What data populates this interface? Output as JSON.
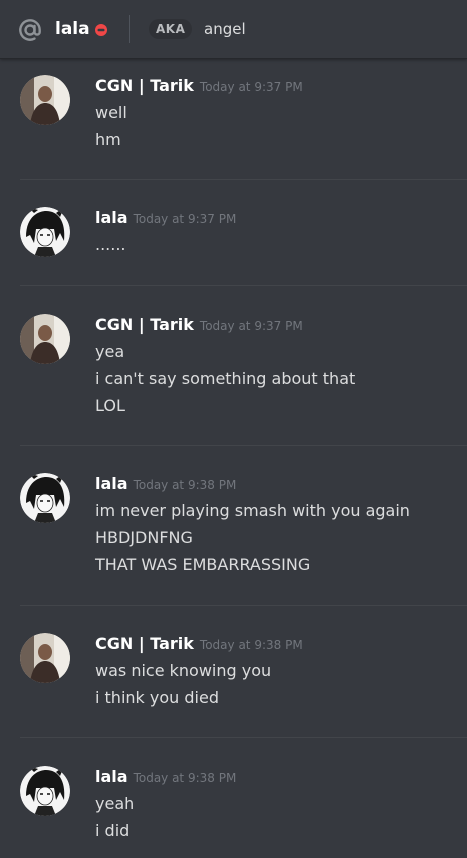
{
  "header": {
    "channel_name": "lala",
    "status": "do-not-disturb",
    "aka_label": "AKA",
    "aka_name": "angel",
    "icons": {
      "mention": "at-sign-icon",
      "status": "dnd-status-icon"
    }
  },
  "colors": {
    "background": "#36393f",
    "author": "#ffffff",
    "text": "#dcddde",
    "timestamp": "#72767d",
    "dnd": "#f04747"
  },
  "messages": [
    {
      "author": "CGN | Tarik",
      "timestamp": "Today at 9:37 PM",
      "avatar": "tarik-avatar",
      "lines": [
        "well",
        "hm"
      ]
    },
    {
      "author": "lala",
      "timestamp": "Today at 9:37 PM",
      "avatar": "lala-avatar",
      "lines": [
        "......"
      ]
    },
    {
      "author": "CGN | Tarik",
      "timestamp": "Today at 9:37 PM",
      "avatar": "tarik-avatar",
      "lines": [
        "yea",
        "i can't say something about that",
        "LOL"
      ]
    },
    {
      "author": "lala",
      "timestamp": "Today at 9:38 PM",
      "avatar": "lala-avatar",
      "lines": [
        "im never playing smash with you again",
        "HBDJDNFNG",
        "THAT WAS EMBARRASSING"
      ]
    },
    {
      "author": "CGN | Tarik",
      "timestamp": "Today at 9:38 PM",
      "avatar": "tarik-avatar",
      "lines": [
        "was nice knowing you",
        "i think you died"
      ]
    },
    {
      "author": "lala",
      "timestamp": "Today at 9:38 PM",
      "avatar": "lala-avatar",
      "lines": [
        "yeah",
        "i did"
      ]
    }
  ]
}
